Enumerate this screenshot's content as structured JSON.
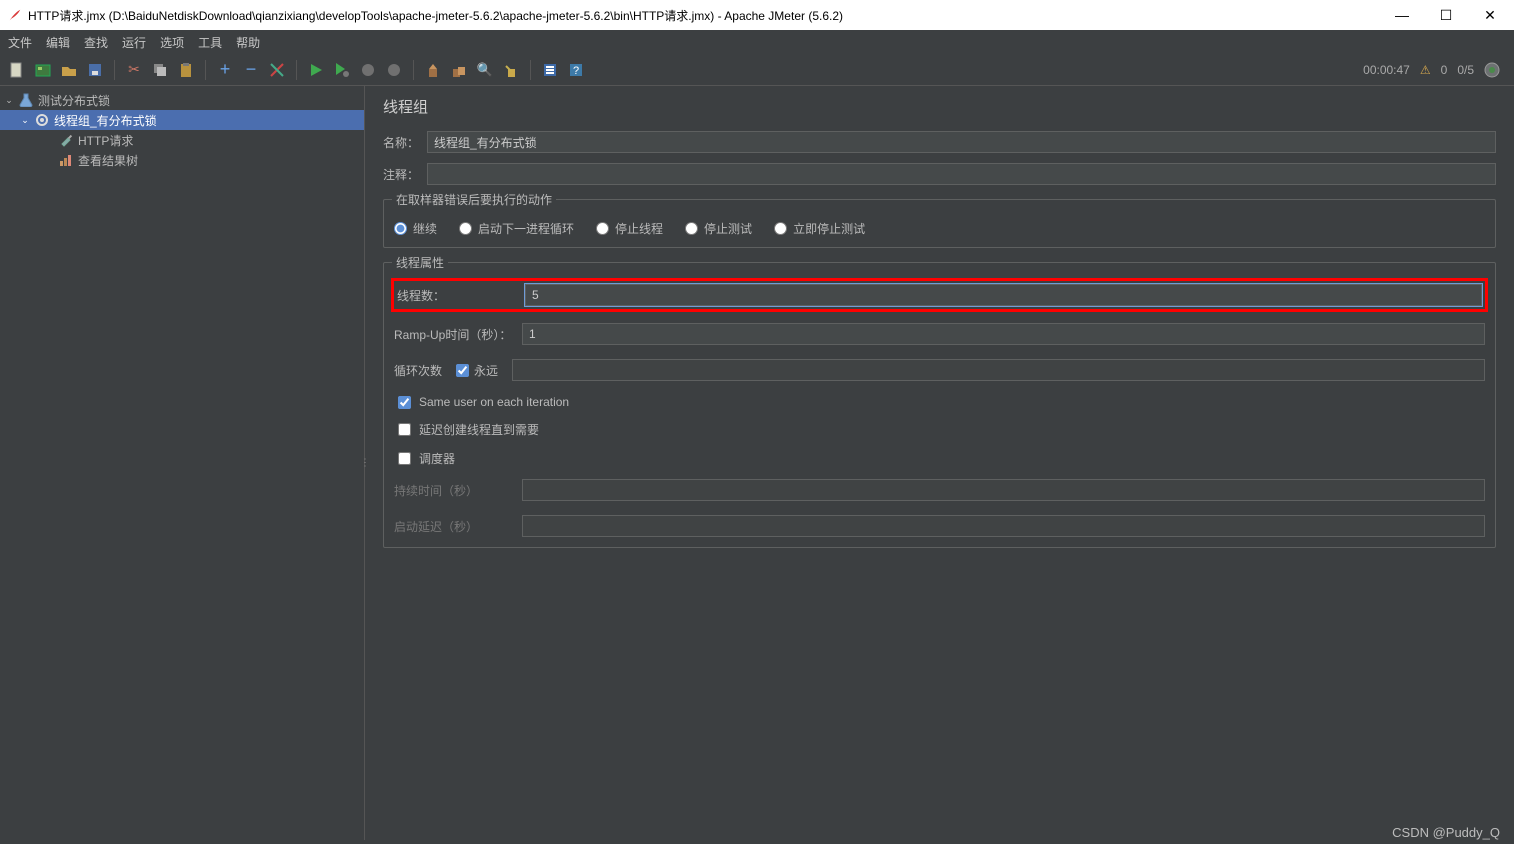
{
  "window": {
    "title": "HTTP请求.jmx (D:\\BaiduNetdiskDownload\\qianzixiang\\developTools\\apache-jmeter-5.6.2\\apache-jmeter-5.6.2\\bin\\HTTP请求.jmx) - Apache JMeter (5.6.2)",
    "minimize": "—",
    "maximize": "☐",
    "close": "✕"
  },
  "menu": {
    "file": "文件",
    "edit": "编辑",
    "search": "查找",
    "run": "运行",
    "options": "选项",
    "tools": "工具",
    "help": "帮助"
  },
  "status": {
    "elapsed": "00:00:47",
    "threads": "0/5",
    "active": "0"
  },
  "tree": {
    "root": "测试分布式锁",
    "threadGroup": "线程组_有分布式锁",
    "http": "HTTP请求",
    "results": "查看结果树"
  },
  "panel": {
    "title": "线程组",
    "name_label": "名称：",
    "name_value": "线程组_有分布式锁",
    "comment_label": "注释：",
    "comment_value": "",
    "errorActionLegend": "在取样器错误后要执行的动作",
    "opt_continue": "继续",
    "opt_nextloop": "启动下一进程循环",
    "opt_stopthread": "停止线程",
    "opt_stoptest": "停止测试",
    "opt_stopnow": "立即停止测试",
    "threadPropsLegend": "线程属性",
    "threads_label": "线程数：",
    "threads_value": "5",
    "rampup_label": "Ramp-Up时间（秒）：",
    "rampup_value": "1",
    "loop_label": "循环次数",
    "forever_label": "永远",
    "loop_value": "",
    "sameuser_label": "Same user on each iteration",
    "delay_label": "延迟创建线程直到需要",
    "scheduler_label": "调度器",
    "duration_label": "持续时间（秒）",
    "startup_label": "启动延迟（秒）"
  },
  "watermark": "CSDN @Puddy_Q"
}
